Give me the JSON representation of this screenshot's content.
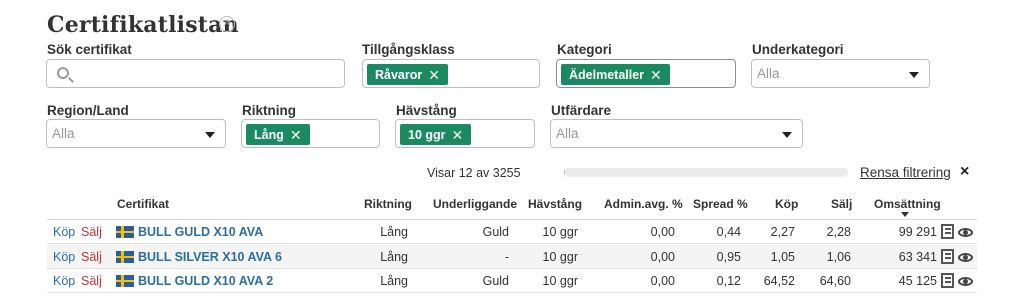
{
  "page": {
    "title": "Certifikatlistan"
  },
  "filters": {
    "search": {
      "label": "Sök certifikat",
      "value": ""
    },
    "asset_class": {
      "label": "Tillgångsklass",
      "chip": "Råvaror"
    },
    "category": {
      "label": "Kategori",
      "chip": "Ädelmetaller"
    },
    "subcategory": {
      "label": "Underkategori",
      "value": "Alla"
    },
    "region": {
      "label": "Region/Land",
      "value": "Alla"
    },
    "direction": {
      "label": "Riktning",
      "chip": "Lång"
    },
    "leverage": {
      "label": "Hävstång",
      "chip": "10 ggr"
    },
    "issuer": {
      "label": "Utfärdare",
      "value": "Alla"
    }
  },
  "status": {
    "showing": "Visar 12 av 3255",
    "progress_fraction": 0.004,
    "clear_label": "Rensa filtrering",
    "clear_icon": "×"
  },
  "table": {
    "headers": {
      "certificate": "Certifikat",
      "direction": "Riktning",
      "underlying": "Underliggande",
      "leverage": "Hävstång",
      "admin_fee": "Admin.avg. %",
      "spread": "Spread %",
      "buy": "Köp",
      "sell": "Sälj",
      "turnover": "Omsättning"
    },
    "rows": [
      {
        "buy_label": "Köp",
        "sell_label": "Sälj",
        "name": "BULL GULD X10 AVA",
        "direction": "Lång",
        "underlying": "Guld",
        "leverage": "10 ggr",
        "admin_fee": "0,00",
        "spread": "0,44",
        "buy": "2,27",
        "sell": "2,28",
        "turnover": "99 291"
      },
      {
        "buy_label": "Köp",
        "sell_label": "Sälj",
        "name": "BULL SILVER X10 AVA 6",
        "direction": "Lång",
        "underlying": "-",
        "leverage": "10 ggr",
        "admin_fee": "0,00",
        "spread": "0,95",
        "buy": "1,05",
        "sell": "1,06",
        "turnover": "63 341"
      },
      {
        "buy_label": "Köp",
        "sell_label": "Sälj",
        "name": "BULL GULD X10 AVA 2",
        "direction": "Lång",
        "underlying": "Guld",
        "leverage": "10 ggr",
        "admin_fee": "0,00",
        "spread": "0,12",
        "buy": "64,52",
        "sell": "64,60",
        "turnover": "45 125"
      }
    ]
  }
}
